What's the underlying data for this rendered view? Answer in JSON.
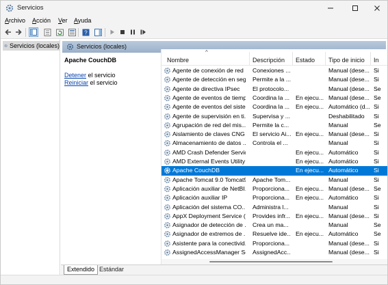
{
  "window": {
    "title": "Servicios"
  },
  "menu": [
    {
      "label": "Archivo"
    },
    {
      "label": "Acción"
    },
    {
      "label": "Ver"
    },
    {
      "label": "Ayuda"
    }
  ],
  "tree": {
    "root_label": "Servicios (locales)"
  },
  "pane": {
    "header_label": "Servicios (locales)",
    "selected_service": "Apache CouchDB",
    "actions": [
      {
        "link": "Detener",
        "rest": " el servicio"
      },
      {
        "link": "Reiniciar",
        "rest": " el servicio"
      }
    ]
  },
  "columns": {
    "name": "Nombre",
    "description": "Descripción",
    "state": "Estado",
    "startup": "Tipo de inicio",
    "logon": "In"
  },
  "rows": [
    {
      "name": "Agente de conexión de red",
      "description": "Conexiones ...",
      "state": "",
      "startup": "Manual (dese...",
      "logon": "Si"
    },
    {
      "name": "Agente de detección en seg...",
      "description": "Permite a la ...",
      "state": "",
      "startup": "Manual (dese...",
      "logon": "Si"
    },
    {
      "name": "Agente de directiva IPsec",
      "description": "El protocolo...",
      "state": "",
      "startup": "Manual (dese...",
      "logon": "Se"
    },
    {
      "name": "Agente de eventos de tiempo",
      "description": "Coordina la ...",
      "state": "En ejecu...",
      "startup": "Manual (dese...",
      "logon": "Se"
    },
    {
      "name": "Agente de eventos del siste...",
      "description": "Coordina la ...",
      "state": "En ejecu...",
      "startup": "Automático (d...",
      "logon": "Si"
    },
    {
      "name": "Agente de supervisión en ti...",
      "description": "Supervisa y ...",
      "state": "",
      "startup": "Deshabilitado",
      "logon": "Si"
    },
    {
      "name": "Agrupación de red del mis...",
      "description": "Permite la c...",
      "state": "",
      "startup": "Manual",
      "logon": "Se"
    },
    {
      "name": "Aislamiento de claves CNG",
      "description": "El servicio Ai...",
      "state": "En ejecu...",
      "startup": "Manual (dese...",
      "logon": "Si"
    },
    {
      "name": "Almacenamiento de datos ...",
      "description": "Controla el ...",
      "state": "",
      "startup": "Manual",
      "logon": "Si"
    },
    {
      "name": "AMD Crash Defender Service",
      "description": "",
      "state": "En ejecu...",
      "startup": "Automático",
      "logon": "Si"
    },
    {
      "name": "AMD External Events Utility",
      "description": "",
      "state": "En ejecu...",
      "startup": "Automático",
      "logon": "Si"
    },
    {
      "name": "Apache CouchDB",
      "description": "",
      "state": "En ejecu...",
      "startup": "Automático",
      "logon": "Si",
      "selected": true
    },
    {
      "name": "Apache Tomcat 9.0 Tomcat9",
      "description": "Apache Tom...",
      "state": "",
      "startup": "Manual",
      "logon": "Si"
    },
    {
      "name": "Aplicación auxiliar de NetBI...",
      "description": "Proporciona...",
      "state": "En ejecu...",
      "startup": "Manual (dese...",
      "logon": "Se"
    },
    {
      "name": "Aplicación auxiliar IP",
      "description": "Proporciona...",
      "state": "En ejecu...",
      "startup": "Automático",
      "logon": "Si"
    },
    {
      "name": "Aplicación del sistema CO...",
      "description": "Administra l...",
      "state": "",
      "startup": "Manual",
      "logon": "Si"
    },
    {
      "name": "AppX Deployment Service (...",
      "description": "Provides infr...",
      "state": "En ejecu...",
      "startup": "Manual (dese...",
      "logon": "Si"
    },
    {
      "name": "Asignador de detección de ...",
      "description": "Crea un ma...",
      "state": "",
      "startup": "Manual",
      "logon": "Se"
    },
    {
      "name": "Asignador de extremos de ...",
      "description": "Resuelve ide...",
      "state": "En ejecu...",
      "startup": "Automático",
      "logon": "Se"
    },
    {
      "name": "Asistente para la conectivid...",
      "description": "Proporciona...",
      "state": "",
      "startup": "Manual (dese...",
      "logon": "Si"
    },
    {
      "name": "AssignedAccessManager Se...",
      "description": "AssignedAcc...",
      "state": "",
      "startup": "Manual (dese...",
      "logon": "Si"
    }
  ],
  "tabs": [
    {
      "label": "Extendido"
    },
    {
      "label": "Estándar"
    }
  ],
  "colors": {
    "selection": "#0078d7",
    "link": "#0645ad",
    "header_band": "#aabdd4"
  }
}
